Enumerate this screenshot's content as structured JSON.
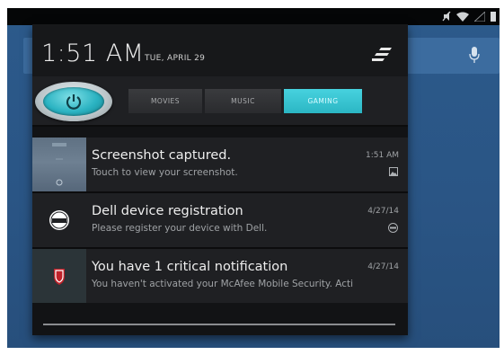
{
  "header": {
    "time": "1:51 AM",
    "date": "TUE, APRIL 29"
  },
  "modes": {
    "tabs": [
      {
        "label": "MOVIES",
        "active": false
      },
      {
        "label": "MUSIC",
        "active": false
      },
      {
        "label": "GAMING",
        "active": true
      }
    ]
  },
  "notifications": [
    {
      "title": "Screenshot captured.",
      "body": "Touch to view your screenshot.",
      "time": "1:51 AM",
      "icon": "image-icon"
    },
    {
      "title": "Dell device registration",
      "body": "Please register your device with Dell.",
      "time": "4/27/14",
      "icon": "dell-logo-icon"
    },
    {
      "title": "You have 1 critical notification",
      "body": "You haven't activated your McAfee Mobile Security. Acti",
      "time": "4/27/14",
      "icon": "mcafee-shield-icon"
    }
  ],
  "colors": {
    "accent": "#2bb6c4",
    "shade": "#121315",
    "wallpaper": "#2a5585"
  }
}
